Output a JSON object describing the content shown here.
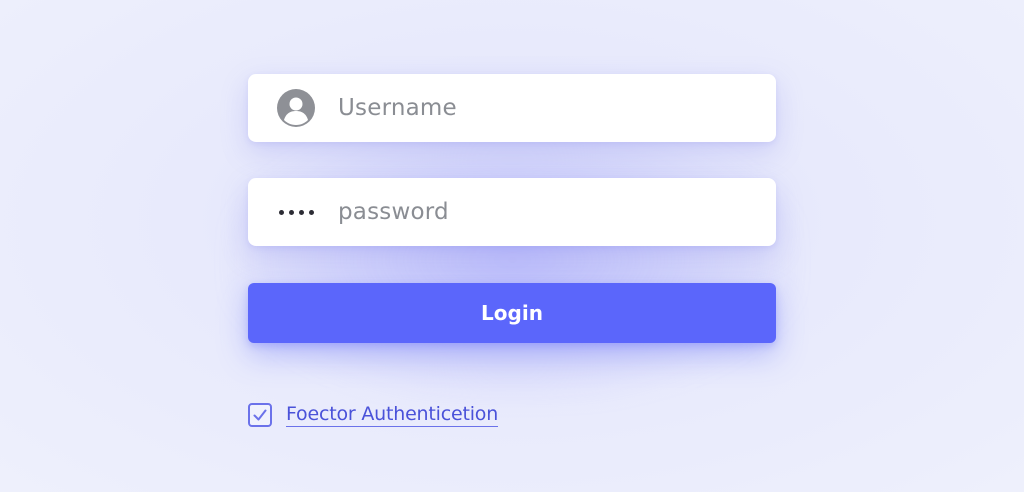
{
  "login_form": {
    "username": {
      "placeholder": "Username",
      "icon": "user-avatar-icon"
    },
    "password": {
      "placeholder": "password",
      "icon": "password-dots-icon"
    },
    "login_button": {
      "label": "Login",
      "color": "#5b66fb"
    },
    "mfa": {
      "label": "Foector Authenticetion",
      "checked": true,
      "icon": "checkmark-icon"
    }
  },
  "colors": {
    "background": "#eef0fc",
    "accent": "#5b66fb",
    "link": "#4a52d9",
    "placeholder": "#8a8d93"
  }
}
